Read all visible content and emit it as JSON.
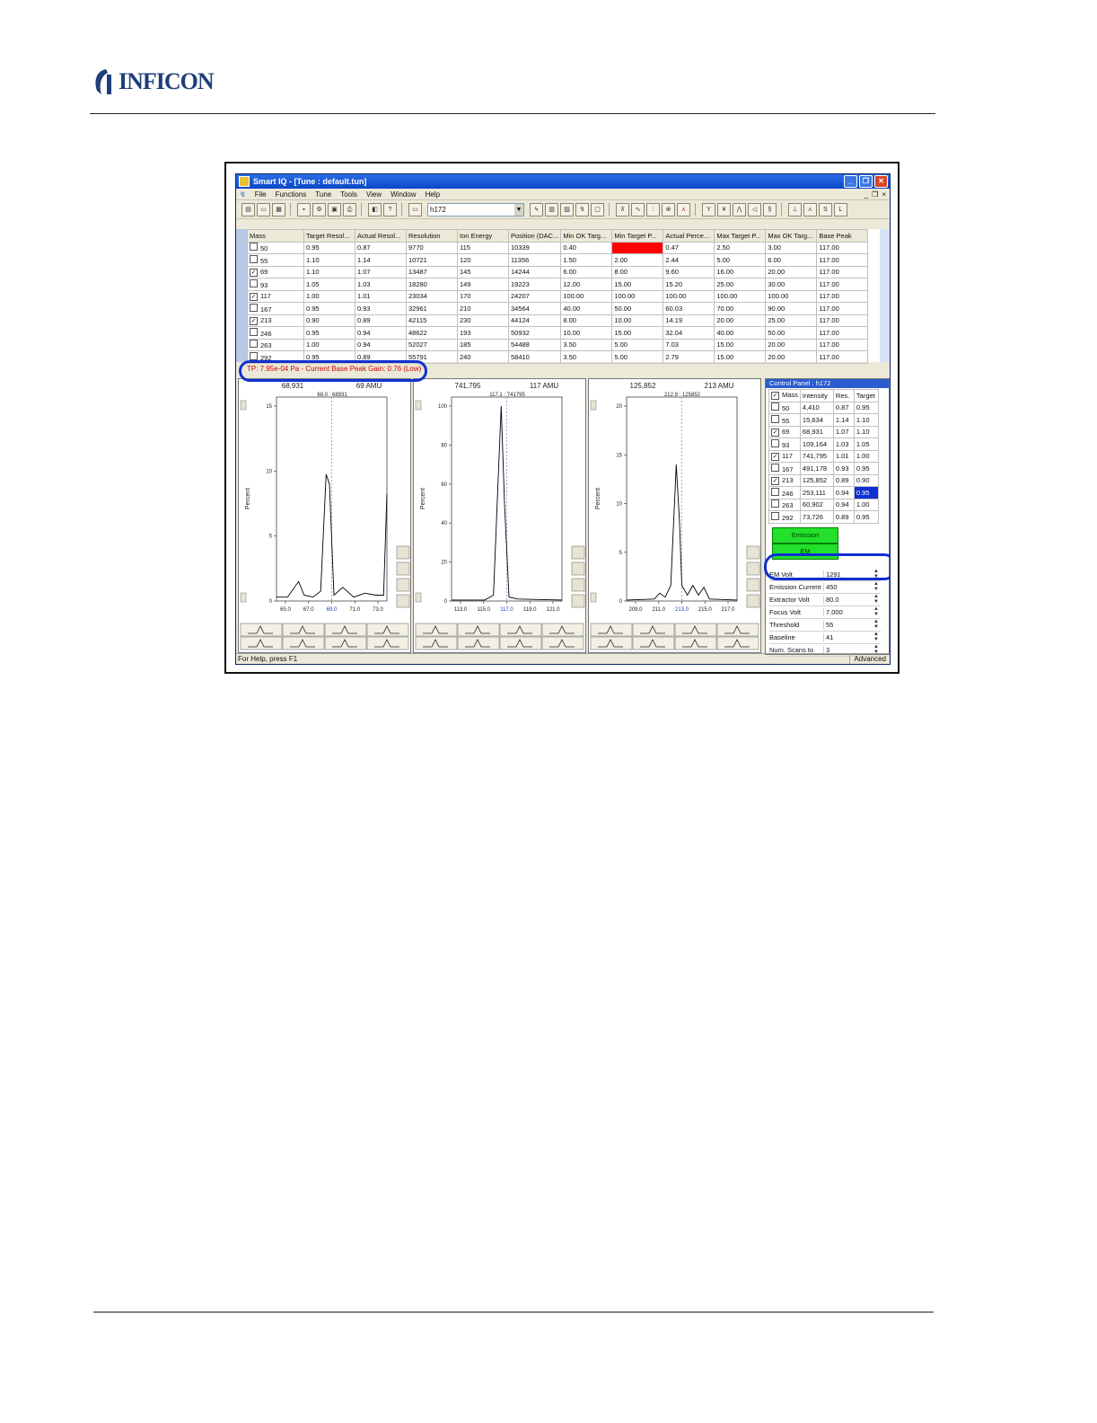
{
  "brand": {
    "name": "INFICON"
  },
  "window": {
    "title": "Smart IQ - [Tune : default.tun]",
    "menu": [
      "File",
      "Functions",
      "Tune",
      "Tools",
      "View",
      "Window",
      "Help"
    ],
    "combo_value": "h172",
    "grid": {
      "columns": [
        "Mass",
        "Target Resol...",
        "Actual Resol...",
        "Resolution",
        "Ion Energy",
        "Position (DAC...",
        "Min OK Targ...",
        "Min Target P...",
        "Actual Perce...",
        "Max Target P...",
        "Max OK Targ...",
        "Base Peak"
      ],
      "rows": [
        {
          "checked": false,
          "cells": [
            "50",
            "0.95",
            "0.87",
            "9770",
            "115",
            "10339",
            "0.40",
            "0.50",
            "0.47",
            "2.50",
            "3.00",
            "117.00"
          ],
          "alert": true
        },
        {
          "checked": false,
          "cells": [
            "55",
            "1.10",
            "1.14",
            "10721",
            "120",
            "11356",
            "1.50",
            "2.00",
            "2.44",
            "5.00",
            "6.00",
            "117.00"
          ]
        },
        {
          "checked": true,
          "cells": [
            "69",
            "1.10",
            "1.07",
            "13487",
            "145",
            "14244",
            "6.00",
            "8.00",
            "9.60",
            "16.00",
            "20.00",
            "117.00"
          ]
        },
        {
          "checked": false,
          "cells": [
            "93",
            "1.05",
            "1.03",
            "18280",
            "149",
            "19223",
            "12.00",
            "15.00",
            "15.20",
            "25.00",
            "30.00",
            "117.00"
          ]
        },
        {
          "checked": true,
          "cells": [
            "117",
            "1.00",
            "1.01",
            "23034",
            "170",
            "24207",
            "100.00",
            "100.00",
            "100.00",
            "100.00",
            "100.00",
            "117.00"
          ]
        },
        {
          "checked": false,
          "cells": [
            "167",
            "0.95",
            "0.93",
            "32961",
            "210",
            "34564",
            "40.00",
            "50.00",
            "60.03",
            "70.00",
            "90.00",
            "117.00"
          ]
        },
        {
          "checked": true,
          "cells": [
            "213",
            "0.90",
            "0.89",
            "42115",
            "230",
            "44124",
            "8.00",
            "10.00",
            "14.19",
            "20.00",
            "25.00",
            "117.00"
          ]
        },
        {
          "checked": false,
          "cells": [
            "246",
            "0.95",
            "0.94",
            "48622",
            "193",
            "50932",
            "10.00",
            "15.00",
            "32.04",
            "40.00",
            "50.00",
            "117.00"
          ]
        },
        {
          "checked": false,
          "cells": [
            "263",
            "1.00",
            "0.94",
            "52027",
            "185",
            "54488",
            "3.50",
            "5.00",
            "7.03",
            "15.00",
            "20.00",
            "117.00"
          ]
        },
        {
          "checked": false,
          "cells": [
            "292",
            "0.95",
            "0.89",
            "55791",
            "240",
            "58410",
            "3.50",
            "5.00",
            "2.79",
            "15.00",
            "20.00",
            "117.00"
          ]
        }
      ]
    },
    "status_message": "TP: 7.95e-04 Pa - Current Base Peak Gain: 0.76 (Low)",
    "plots": [
      {
        "intensity": "68,931",
        "mass_label": "69 AMU",
        "peak_label": "69.0 : 68931",
        "ylabel": "Percent",
        "yticks": [
          "15",
          "10",
          "5",
          "0"
        ],
        "xticks": [
          "65.0",
          "67.0",
          "69.0",
          "71.0",
          "73.0"
        ]
      },
      {
        "intensity": "741,795",
        "mass_label": "117 AMU",
        "peak_label": "117.1 : 741795",
        "ylabel": "Percent",
        "yticks": [
          "100",
          "80",
          "60",
          "40",
          "20",
          "0"
        ],
        "xticks": [
          "113.0",
          "115.0",
          "117.0",
          "119.0",
          "121.0"
        ]
      },
      {
        "intensity": "125,852",
        "mass_label": "213 AMU",
        "peak_label": "212.9 : 125852",
        "ylabel": "Percent",
        "yticks": [
          "20",
          "15",
          "10",
          "5",
          "0"
        ],
        "xticks": [
          "209.0",
          "211.0",
          "213.0",
          "215.0",
          "217.0"
        ]
      }
    ],
    "control_panel": {
      "title": "Control Panel : h172",
      "headers": [
        "Mass",
        "Intensity",
        "Res.",
        "Target"
      ],
      "rows": [
        {
          "checked": false,
          "cells": [
            "50",
            "4,410",
            "0.87",
            "0.95"
          ]
        },
        {
          "checked": false,
          "cells": [
            "55",
            "15,634",
            "1.14",
            "1.10"
          ]
        },
        {
          "checked": true,
          "cells": [
            "69",
            "68,931",
            "1.07",
            "1.10"
          ]
        },
        {
          "checked": false,
          "cells": [
            "93",
            "109,164",
            "1.03",
            "1.05"
          ]
        },
        {
          "checked": true,
          "cells": [
            "117",
            "741,795",
            "1.01",
            "1.00"
          ]
        },
        {
          "checked": false,
          "cells": [
            "167",
            "491,178",
            "0.93",
            "0.95"
          ]
        },
        {
          "checked": true,
          "cells": [
            "213",
            "125,852",
            "0.89",
            "0.90"
          ]
        },
        {
          "checked": false,
          "cells": [
            "246",
            "253,111",
            "0.94",
            "0.95"
          ]
        },
        {
          "checked": false,
          "cells": [
            "263",
            "60,902",
            "0.94",
            "1.00"
          ]
        },
        {
          "checked": false,
          "cells": [
            "292",
            "73,726",
            "0.89",
            "0.95"
          ]
        }
      ],
      "emission_label": "Emission",
      "em_label": "EM",
      "properties": [
        {
          "label": "EM Volt",
          "value": "1291"
        },
        {
          "label": "Emission Current",
          "value": "450"
        },
        {
          "label": "Extractor Volt",
          "value": "80.0"
        },
        {
          "label": "Focus Volt",
          "value": "7.000"
        },
        {
          "label": "Threshold",
          "value": "55"
        },
        {
          "label": "Baseline",
          "value": "41"
        },
        {
          "label": "Num. Scans to",
          "value": "3"
        }
      ]
    },
    "statusbar": {
      "left": "For Help, press F1",
      "right": "Advanced"
    }
  },
  "colors": {
    "alert": "#ff0000",
    "highlight": "#1030d0",
    "green": "#22e02c"
  }
}
